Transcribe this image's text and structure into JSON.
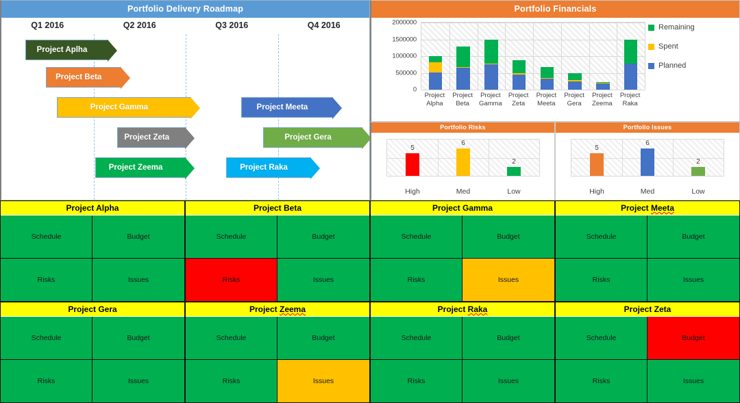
{
  "roadmap": {
    "title": "Portfolio Delivery Roadmap",
    "quarters": [
      "Q1 2016",
      "Q2 2016",
      "Q3 2016",
      "Q4 2016"
    ],
    "bars": [
      {
        "label": "Project Aplha",
        "color": "#375623",
        "start": 0.13,
        "end": 0.58,
        "row": 0
      },
      {
        "label": "Project Beta",
        "color": "#ed7d31",
        "start": 0.24,
        "end": 0.65,
        "row": 1
      },
      {
        "label": "Project Gamma",
        "color": "#ffc000",
        "start": 0.3,
        "end": 1.03,
        "row": 2
      },
      {
        "label": "Project Meeta",
        "color": "#4472c4",
        "start": 1.3,
        "end": 1.8,
        "row": 2
      },
      {
        "label": "Project Zeta",
        "color": "#808080",
        "start": 0.63,
        "end": 1.0,
        "row": 3
      },
      {
        "label": "Project Gera",
        "color": "#70ad47",
        "start": 1.42,
        "end": 1.96,
        "row": 3
      },
      {
        "label": "Project Zeema",
        "color": "#00b050",
        "start": 0.51,
        "end": 1.0,
        "row": 4
      },
      {
        "label": "Project Raka",
        "color": "#00b0f0",
        "start": 1.22,
        "end": 1.68,
        "row": 4
      }
    ]
  },
  "financials": {
    "title": "Portfolio Financials"
  },
  "risks": {
    "title": "Portfolio Risks"
  },
  "issues": {
    "title": "Portfolio Issues"
  },
  "chart_data": [
    {
      "type": "bar",
      "id": "portfolio-financials",
      "title": "Portfolio Financials",
      "stacked": true,
      "xlabel": "",
      "ylabel": "",
      "ylim": [
        0,
        2000000
      ],
      "yticks": [
        0,
        500000,
        1000000,
        1500000,
        2000000
      ],
      "ytick_labels": [
        "0",
        "500000",
        "1000000",
        "1500000",
        "2000000"
      ],
      "grid": true,
      "legend_position": "right",
      "categories": [
        "Project Alpha",
        "Project Beta",
        "Project Gamma",
        "Project Zeta",
        "Project Meeta",
        "Project Gera",
        "Project Zeema",
        "Project Raka"
      ],
      "series": [
        {
          "name": "Planned",
          "color": "#4472c4",
          "values": [
            510000,
            650000,
            760000,
            450000,
            330000,
            240000,
            190000,
            770000
          ]
        },
        {
          "name": "Spent",
          "color": "#ffc000",
          "values": [
            300000,
            30000,
            20000,
            30000,
            20000,
            40000,
            10000,
            10000
          ]
        },
        {
          "name": "Remaining",
          "color": "#00b050",
          "values": [
            190000,
            600000,
            720000,
            400000,
            330000,
            210000,
            20000,
            720000
          ]
        }
      ]
    },
    {
      "type": "bar",
      "id": "portfolio-risks",
      "title": "Portfolio Risks",
      "categories": [
        "High",
        "Med",
        "Low"
      ],
      "values": [
        5,
        6,
        2
      ],
      "colors": [
        "#ff0000",
        "#ffc000",
        "#00b050"
      ],
      "ylim": [
        0,
        8
      ],
      "grid": true,
      "data_labels": [
        "5",
        "6",
        "2"
      ]
    },
    {
      "type": "bar",
      "id": "portfolio-issues",
      "title": "Portfolio Issues",
      "categories": [
        "High",
        "Med",
        "Low"
      ],
      "values": [
        5,
        6,
        2
      ],
      "colors": [
        "#ed7d31",
        "#4472c4",
        "#70ad47"
      ],
      "ylim": [
        0,
        8
      ],
      "grid": true,
      "data_labels": [
        "5",
        "6",
        "2"
      ]
    }
  ],
  "status_labels": {
    "schedule": "Schedule",
    "budget": "Budget",
    "risks": "Risks",
    "issues": "Issues"
  },
  "cards": [
    {
      "name": "Project Alpha",
      "misspelled": false,
      "schedule": "g",
      "budget": "g",
      "risks": "g",
      "issues": "g"
    },
    {
      "name": "Project Beta",
      "misspelled": false,
      "schedule": "g",
      "budget": "g",
      "risks": "r",
      "issues": "g"
    },
    {
      "name": "Project Gamma",
      "misspelled": false,
      "schedule": "g",
      "budget": "g",
      "risks": "g",
      "issues": "a"
    },
    {
      "name": "Project Meeta",
      "misspelled": true,
      "schedule": "g",
      "budget": "g",
      "risks": "g",
      "issues": "g"
    },
    {
      "name": "Project Gera",
      "misspelled": false,
      "schedule": "g",
      "budget": "g",
      "risks": "g",
      "issues": "g"
    },
    {
      "name": "Project Zeema",
      "misspelled": true,
      "schedule": "g",
      "budget": "g",
      "risks": "g",
      "issues": "a"
    },
    {
      "name": "Project Raka",
      "misspelled": true,
      "schedule": "g",
      "budget": "g",
      "risks": "g",
      "issues": "g"
    },
    {
      "name": "Project Zeta",
      "misspelled": false,
      "schedule": "g",
      "budget": "r",
      "risks": "g",
      "issues": "g"
    }
  ]
}
